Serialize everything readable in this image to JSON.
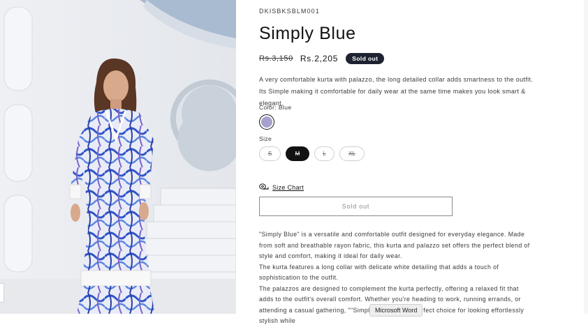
{
  "product": {
    "sku": "DKISBKSBLM001",
    "title": "Simply Blue",
    "price_old": "Rs.3,150",
    "price_new": "Rs.2,205",
    "badge": "Sold out",
    "short_description": "A very comfortable kurta with palazzo, the long detailed collar adds smartness to the outfit. Its Simple making it comfortable for daily wear at the same time makes you look smart & elegant."
  },
  "color": {
    "label": "Color: Blue",
    "swatch_hex": "#a6a2cd"
  },
  "size": {
    "label": "Size",
    "options": [
      "S",
      "M",
      "L",
      "XL"
    ],
    "selected": "M"
  },
  "size_chart": {
    "label": "Size Chart",
    "icon": "tape-measure-icon"
  },
  "buy_button": {
    "label": "Sold out"
  },
  "description": {
    "paragraphs": [
      "\"Simply Blue\" is a versatile and comfortable outfit designed for everyday elegance. Made from soft and breathable rayon fabric, this kurta and palazzo set offers the perfect blend of style and comfort, making it ideal for daily wear.",
      "The kurta features a long collar with delicate white detailing that adds a touch of sophistication to the outfit.",
      "The palazzos are designed to complement the kurta perfectly, offering a relaxed fit that adds to the outfit's overall comfort. Whether you're heading to work, running errands, or attending a casual gathering, \"\"Simply Blue\"\" is the perfect choice for looking effortlessly stylish while"
    ]
  },
  "tooltip": {
    "text": "Microsoft Word"
  },
  "colors": {
    "badge_bg": "#1d2331",
    "selected_size_bg": "#121212",
    "text": "#121212"
  }
}
